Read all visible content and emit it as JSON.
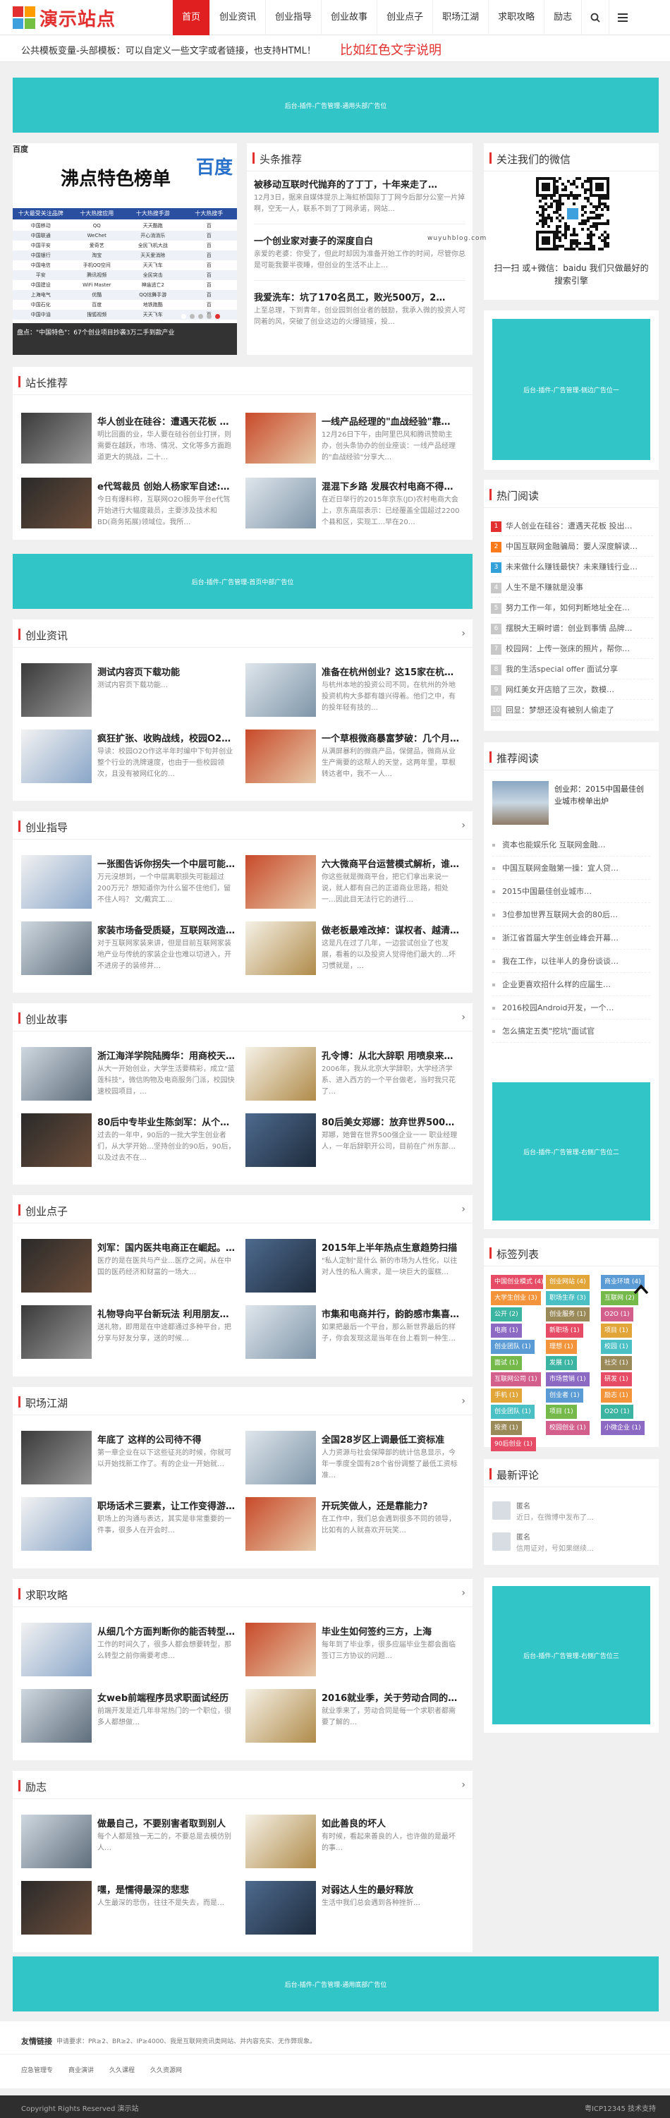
{
  "logo_text": "演示站点",
  "nav": {
    "items": [
      "首页",
      "创业资讯",
      "创业指导",
      "创业故事",
      "创业点子",
      "职场江湖",
      "求职攻略",
      "励志"
    ],
    "search_icon": "search-icon",
    "menu_icon": "menu-icon"
  },
  "notice": {
    "text": "公共模板变量-头部模板：可以自定义一些文字或者链接，也支持HTML！",
    "red_text": "比如红色文字说明"
  },
  "ad_text": "后台-插件-广告管理-通用头部广告位",
  "ad_mid": "后台-插件-广告管理-首页中部广告位",
  "ad_footer": "后台-插件-广告管理-通用底部广告位",
  "ad_side1": "后台-插件-广告管理-侧边广告位一",
  "ad_side2": "后台-插件-广告管理-右侧广告位二",
  "ad_side3": "后台-插件-广告管理-右侧广告位三",
  "slider": {
    "banner_title": "沸点特色榜单",
    "logo_text": "百度",
    "cols": [
      "十大最受关注品牌",
      "十大热搜应用",
      "十大热搜手游",
      "十大热搜手"
    ],
    "rows": [
      [
        "中国移动",
        "QQ",
        "天天酷跑",
        "百"
      ],
      [
        "中国联通",
        "WeChet",
        "开心消消乐",
        "百"
      ],
      [
        "中国平安",
        "爱奇艺",
        "全民飞机大战",
        "百"
      ],
      [
        "中国银行",
        "淘宝",
        "天天爱消除",
        "百"
      ],
      [
        "中国电信",
        "手机QQ空间",
        "天天飞车",
        "百"
      ],
      [
        "平安",
        "腾讯视频",
        "全民突击",
        "百"
      ],
      [
        "中国建设",
        "WiFi Master",
        "神庙逃亡2",
        "百"
      ],
      [
        "上海电气",
        "优酷",
        "QQ炫舞手游",
        "百"
      ],
      [
        "中国石化",
        "百度",
        "地铁跑酷",
        "百"
      ],
      [
        "中国中油",
        "搜狐视频",
        "天天飞车",
        "百"
      ]
    ],
    "caption": "盘点：\"中国特色\"：67个创业项目抄袭3万二手到款产业"
  },
  "headline": {
    "title": "头条推荐",
    "items": [
      {
        "title": "被移动互联时代抛弃的了丁丁，十年来走了…",
        "desc": "12月3日，据来自媒体提示上海虹桥国际丁丁网今后部分公室一片掉啊，空无一人，联系不到了丁网承诺，网站…"
      },
      {
        "title": "一个创业家对妻子的深度自白",
        "desc": "亲爱的老婆：你受了，但此时却因为准备开始工作的时间，尽管你总是可能我要半夜睡，但创业的生活不止上…"
      },
      {
        "title": "我爱洗车：坑了170名员工，败光500万，2…",
        "desc": "上至总理，下到青年，创业园到创业者的鼓励，我承入微的投资人可同着的风，突破了创业这边的火爆链接，投…"
      }
    ]
  },
  "wechat": {
    "title": "关注我们的微信",
    "qr_label": "wuyuhblog.com",
    "caption": "扫一扫 或+微信：baidu 我们只做最好的搜索引擎"
  },
  "recommend": {
    "title": "站长推荐",
    "items": [
      {
        "title": "华人创业在硅谷：遭遇天花板 协…",
        "desc": "明比回面的业，华人要在硅谷创业打拼，则需要在越跃，市场、情况、文化等多方面跑道更大的挑战，二十…"
      },
      {
        "title": "一线产品经理的\"血战经验\"靠…",
        "desc": "12月26日下午，由阿里巴风和腾讯赞助主办，创头条协办的创业座谈：一线产品经理的\"血战经验\"分享大…"
      },
      {
        "title": "e代驾裁员 创始人杨家军自述:我…",
        "desc": "今日有爆料称，互联网O2O服务平台e代驾开始进行大幅度裁员，主要涉及技术和BD(商务拓展)领域位。我所…"
      },
      {
        "title": "混混下乡路 发展农村电商不得不…",
        "desc": "在近日举行的2015年京东(JD)农村电商大会上，京东高层表示：已经覆盖全国超过2200个县和区，实现工…早在20…"
      }
    ]
  },
  "sections": [
    {
      "name": "创业资讯",
      "items": [
        {
          "title": "测试内容页下载功能",
          "desc": "测试内容页下载功能…"
        },
        {
          "title": "准备在杭州创业？这15家在杭州的…",
          "desc": "与杭州本地的投资公司不同，在杭州的外地投资机构大多都有雄兴得着。他们之中，有的投年轻有技的…"
        },
        {
          "title": "疯狂扩张、收购战线，校园O2O…",
          "desc": "导读：校园O2O作这半年时编中下旬并创业整个行业的洗牌速度，也由于一些校园领次，且没有被网红化的…"
        },
        {
          "title": "一个草根微商暴富梦破：几个月赔…",
          "desc": "从满屏暴利的微商产品，保健品，微商从业生产需要的这帮人的天堂，这两年里，草根转达者中，我不一人…"
        }
      ]
    },
    {
      "name": "创业指导",
      "items": [
        {
          "title": "一张图告诉你拐失一个中层可能…",
          "desc": "万元沒想到，一个中层离职损失可能超过200万元？想知道你为什么留不住他们，留不住人吗？ 文/戴宾工…"
        },
        {
          "title": "六大微商平台运营模式解析，谁…",
          "desc": "你这些就是微商平台，把它们拿出来说一说，就人都有自己的正道商业思路，相处一…因此目无法行它的进行…"
        },
        {
          "title": "家装市场备受质疑，互联网改造…",
          "desc": "对于互联网家装来讲，但是目前互联网家装地产业与传统的家装企业也难以切进入，开不进房子的装修并…"
        },
        {
          "title": "做老板最难改掉：谋权者、越清…",
          "desc": "这是凡在过了几年，一边尝试创业了也发展，看着的以及投资人觉得他们最大的…坏习惯就是，…"
        }
      ]
    },
    {
      "name": "创业故事",
      "items": [
        {
          "title": "浙江海洋学院陆腾华：用商校天…",
          "desc": "从大一开始创业，大学生活要精彩，成立\"蓝莲科技\"，微信购物及电商服务门派，校园快速校园项目，…"
        },
        {
          "title": "孔令博：从北大辞职 用喷泉来做…",
          "desc": "2006年，我从北京大学辞职，大学经济学系、进入西方的一个平台做老，当时我只花了…"
        },
        {
          "title": "80后中专毕业生陈剑军：从个人…",
          "desc": "过去的一年中，90后的一批大学生创业者们，从大学开始…坚持创业的90后，90后，以及过去不在…"
        },
        {
          "title": "80后美女郑娜：放弃世界500强…",
          "desc": "郑娜，她曾在世界500强企业一一 职业经理人，一年后辞职开公司，目前在广州东部…"
        }
      ]
    },
    {
      "name": "创业点子",
      "items": [
        {
          "title": "刘军：国内医共电商正在崛起。…",
          "desc": "医疗的是在医共与产业…医疗之间，从在中国的医药经济和财富的一场大…"
        },
        {
          "title": "2015年上半年热点生意趋势扫描",
          "desc": "\"私人定制\"是什么 新的市场为人性化，以往对人性的私人需求，是一块巨大的蛋糕…"
        },
        {
          "title": "礼物导向平台新玩法 利用朋友圈…",
          "desc": "送礼物，即用是在中途都通过多种平台，把分享与好友分享，送的时候…"
        },
        {
          "title": "市集和电商并行，韵韵感市集喜…",
          "desc": "如果把最后一个平台，那么新世界最后的样子，你会发现这是当年在台上看到一种生…"
        }
      ]
    },
    {
      "name": "职场江湖",
      "items": [
        {
          "title": "年底了 这样的公司待不得",
          "desc": "第一章企业在以下这些征兆的时候，你就可以开始找新工作了。有的企业一开始就…"
        },
        {
          "title": "全国28岁区上调最低工资标准",
          "desc": "人力资源与社会保障部的统计信息显示，今年一季度全国有28个省份调整了最低工资标准…"
        },
        {
          "title": "职场话术三要素，让工作变得游…",
          "desc": "职场上的沟通与表达，其实是非常重要的一件事，很多人在开会时…"
        },
        {
          "title": "开玩笑做人，还是靠能力?",
          "desc": "在工作中，我们总会遇到很多不同的领导，比如有的人就喜欢开玩笑…"
        }
      ]
    },
    {
      "name": "求职攻略",
      "items": [
        {
          "title": "从细几个方面判断你的能否转型…",
          "desc": "工作的时间久了，很多人都会想要转型，那么转型之前你需要考虑…"
        },
        {
          "title": "毕业生如何签约三方，上海",
          "desc": "每年到了毕业季，很多应届毕业生都会面临签订三方协议的问题…"
        },
        {
          "title": "女web前端程序员求职面试经历",
          "desc": "前端开发是近几年非常热门的一个职位，很多人都想做…"
        },
        {
          "title": "2016就业季，关于劳动合同的那…",
          "desc": "就业季来了，劳动合同是每一个求职者都需要了解的…"
        }
      ]
    },
    {
      "name": "励志",
      "items": [
        {
          "title": "做最自己，不要别害者取到别人",
          "desc": "每个人都是独一无二的，不要总是去模仿别人…"
        },
        {
          "title": "如此善良的坏人",
          "desc": "有时候，看起来善良的人，也许做的是最坏的事…"
        },
        {
          "title": "嘿，是懦得最深的悲悲",
          "desc": "人生最深的悲伤，往往不是失去，而是…"
        },
        {
          "title": "对弱达人生的最好释放",
          "desc": "生活中我们总会遇到各种挫折…"
        }
      ]
    }
  ],
  "hot": {
    "title": "热门阅读",
    "items": [
      "华人创业在硅谷：遭遇天花板 投出…",
      "中国互联网金融骗局：要人深度解读…",
      "未来做什么赚钱最快？未来赚钱行业…",
      "人生不是不赚就是没事",
      "努力工作一年，如何判断地址全在…",
      "摆脱大王瞬时谱：创业到事情 品牌…",
      "校园网：上传一张床的照片，帮你…",
      "我的生活special offer 面试分享",
      "网红美女开店赔了三次，数模…",
      "回显：梦想还没有被别人偷走了"
    ]
  },
  "rec_read": {
    "title": "推荐阅读",
    "top_title": "创业邦：2015中国最佳创业城市榜单出炉",
    "items": [
      "资本也能娱乐化 互联网金融…",
      "中国互联网金融第一操：宜人贷…",
      "2015中国最佳创业城市…",
      "3位参加世界互联网大会的80后…",
      "浙江省首届大学生创业峰会开幕…",
      "我在工作，以往半人的身份谈谈…",
      "企业更喜欢招什么样的应届生…",
      "2016校园Android开发，一个…",
      "怎么搞定五类\"挖坑\"面试官"
    ]
  },
  "tags": {
    "title": "标签列表",
    "items": [
      "中国创业模式 (4)",
      "创业网站 (4)",
      "商业环境 (4)",
      "大学生创业 (3)",
      "职场生存 (3)",
      "互联网 (2)",
      "公开 (2)",
      "创业服务 (1)",
      "O2O (1)",
      "电商 (1)",
      "新职场 (1)",
      "项目 (1)",
      "创业团队 (1)",
      "理想 (1)",
      "校园 (1)",
      "面试 (1)",
      "发展 (1)",
      "社交 (1)",
      "互联网公司 (1)",
      "市场营销 (1)",
      "研发 (1)",
      "手机 (1)",
      "创业者 (1)",
      "励志 (1)",
      "创业团队 (1)",
      "项目 (1)",
      "O2O (1)",
      "投资 (1)",
      "校园创业 (1)",
      "小微企业 (1)",
      "90后创业 (1)"
    ]
  },
  "comments": {
    "title": "最新评论",
    "items": [
      {
        "name": "匿名",
        "text": "近日，在微博中发布了…"
      },
      {
        "name": "匿名",
        "text": "信用证对，号如果继续…"
      }
    ]
  },
  "footer": {
    "links_label": "友情链接",
    "links_text": "申请要求：PR≥2、BR≥2、IP≥4000、我是互联网资讯类网站、并内容充实、无作弊现象。",
    "links": [
      "应急管理专",
      "商业演讲",
      "久久课程",
      "久久资源网"
    ],
    "copyright": "Copyright Rights Reserved 演示站",
    "icp": "粤ICP12345 技术支持"
  }
}
